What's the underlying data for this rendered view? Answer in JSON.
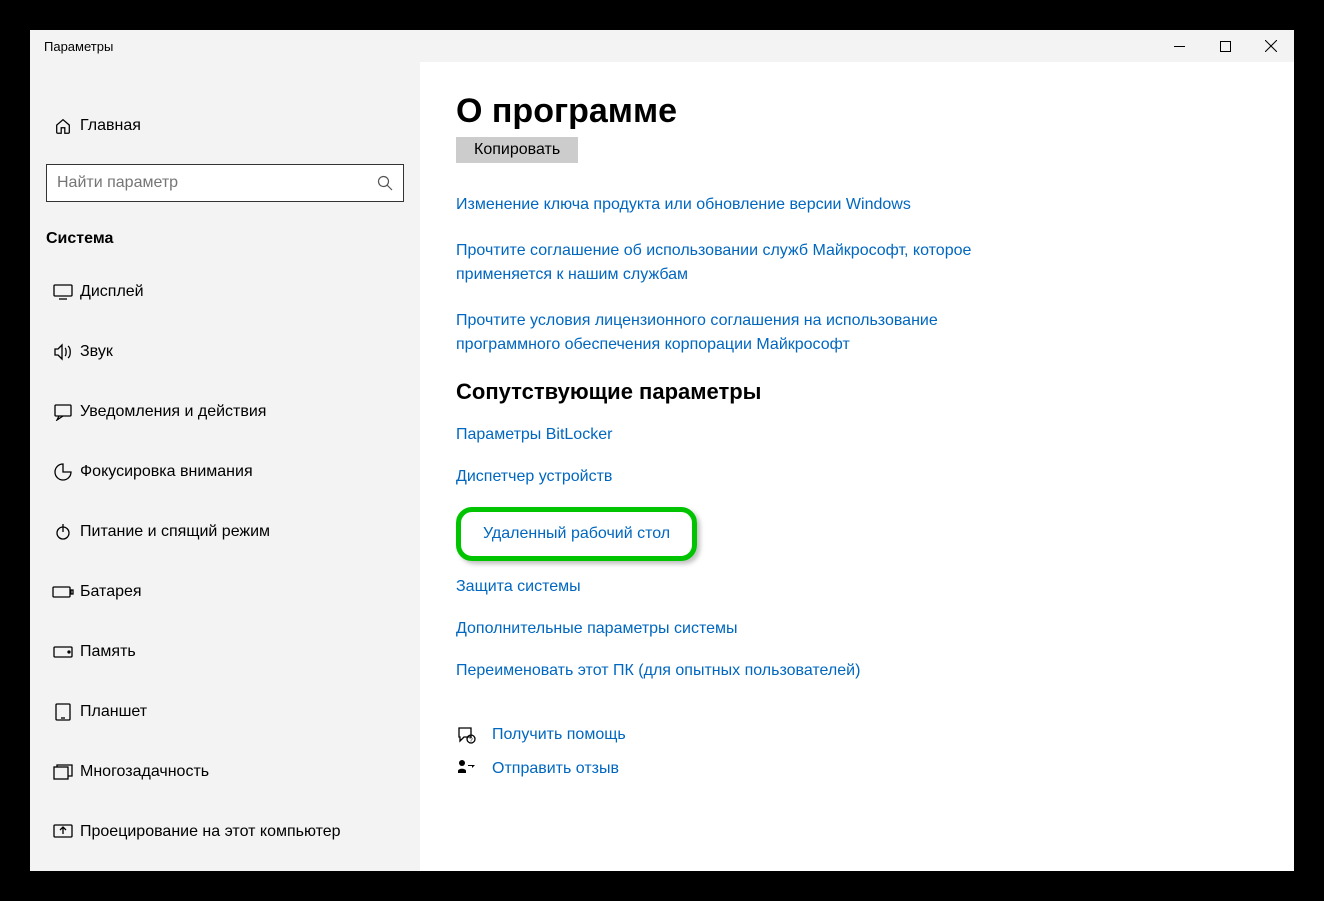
{
  "titlebar": {
    "title": "Параметры"
  },
  "sidebar": {
    "home": "Главная",
    "search_placeholder": "Найти параметр",
    "category": "Система",
    "items": [
      {
        "label": "Дисплей"
      },
      {
        "label": "Звук"
      },
      {
        "label": "Уведомления и действия"
      },
      {
        "label": "Фокусировка внимания"
      },
      {
        "label": "Питание и спящий режим"
      },
      {
        "label": "Батарея"
      },
      {
        "label": "Память"
      },
      {
        "label": "Планшет"
      },
      {
        "label": "Многозадачность"
      },
      {
        "label": "Проецирование на этот компьютер"
      }
    ]
  },
  "main": {
    "heading": "О программе",
    "copy_button": "Копировать",
    "links": [
      "Изменение ключа продукта или обновление версии Windows",
      "Прочтите соглашение об использовании служб Майкрософт, которое применяется к нашим службам",
      "Прочтите условия лицензионного соглашения на использование программного обеспечения корпорации Майкрософт"
    ],
    "related_heading": "Сопутствующие параметры",
    "related": [
      "Параметры BitLocker",
      "Диспетчер устройств",
      "Удаленный рабочий стол",
      "Защита системы",
      "Дополнительные параметры системы",
      "Переименовать этот ПК (для опытных пользователей)"
    ],
    "help": "Получить помощь",
    "feedback": "Отправить отзыв"
  }
}
